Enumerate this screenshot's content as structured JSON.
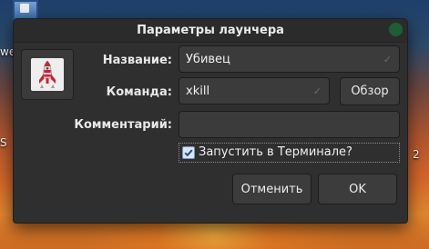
{
  "dialog": {
    "title": "Параметры лаунчера",
    "fields": {
      "name_label": "Название:",
      "name_value": "Убивец",
      "command_label": "Команда:",
      "command_value": "xkill",
      "comment_label": "Комментарий:",
      "comment_value": ""
    },
    "browse_button": "Обзор",
    "terminal_checkbox": {
      "label": "Запустить в Терминале?",
      "checked": true
    },
    "cancel_button": "Отменить",
    "ok_button": "OK"
  },
  "desktop": {
    "left_text_1": "we",
    "left_text_2": "S",
    "right_text": "2"
  },
  "colors": {
    "title_bar_close": "#1e5e35",
    "dialog_bg": "#2f2f2f",
    "field_bg": "#3b3b3b",
    "checkbox_accent": "#6e94c8"
  },
  "icons": {
    "launcher_icon": "rocket-icon",
    "close": "close-icon",
    "check_mark": "checkmark-icon"
  }
}
